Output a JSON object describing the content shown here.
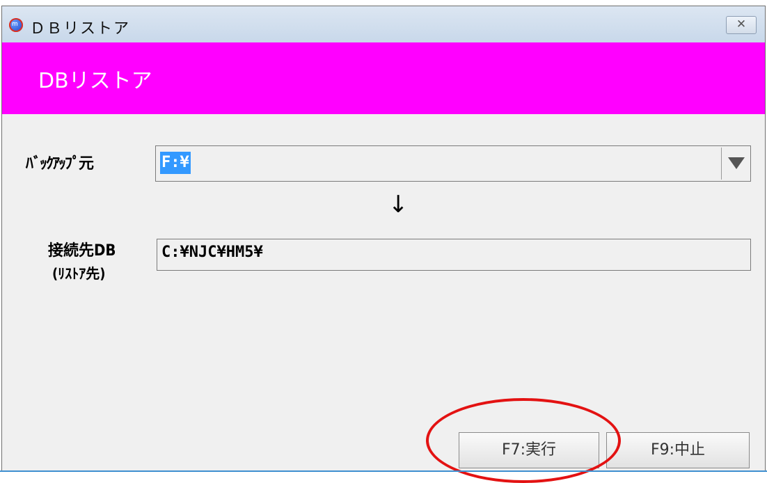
{
  "window": {
    "title": "ＤＢリストア",
    "close_icon": "close-icon"
  },
  "banner": {
    "title": "DBリストア",
    "color": "#ff00ff"
  },
  "form": {
    "source_label": "ﾊﾞｯｸｱｯﾌﾟ元",
    "source_value": "F:¥",
    "dropdown_icon": "chevron-down-icon",
    "arrow": "↓",
    "dest_label": "接続先DB",
    "dest_sublabel": "(ﾘｽﾄｱ先)",
    "dest_value": "C:¥NJC¥HM5¥"
  },
  "buttons": {
    "run_label": "F7:実行",
    "cancel_label": "F9:中止"
  },
  "annotation": {
    "shape": "ellipse",
    "color": "#e31212"
  }
}
